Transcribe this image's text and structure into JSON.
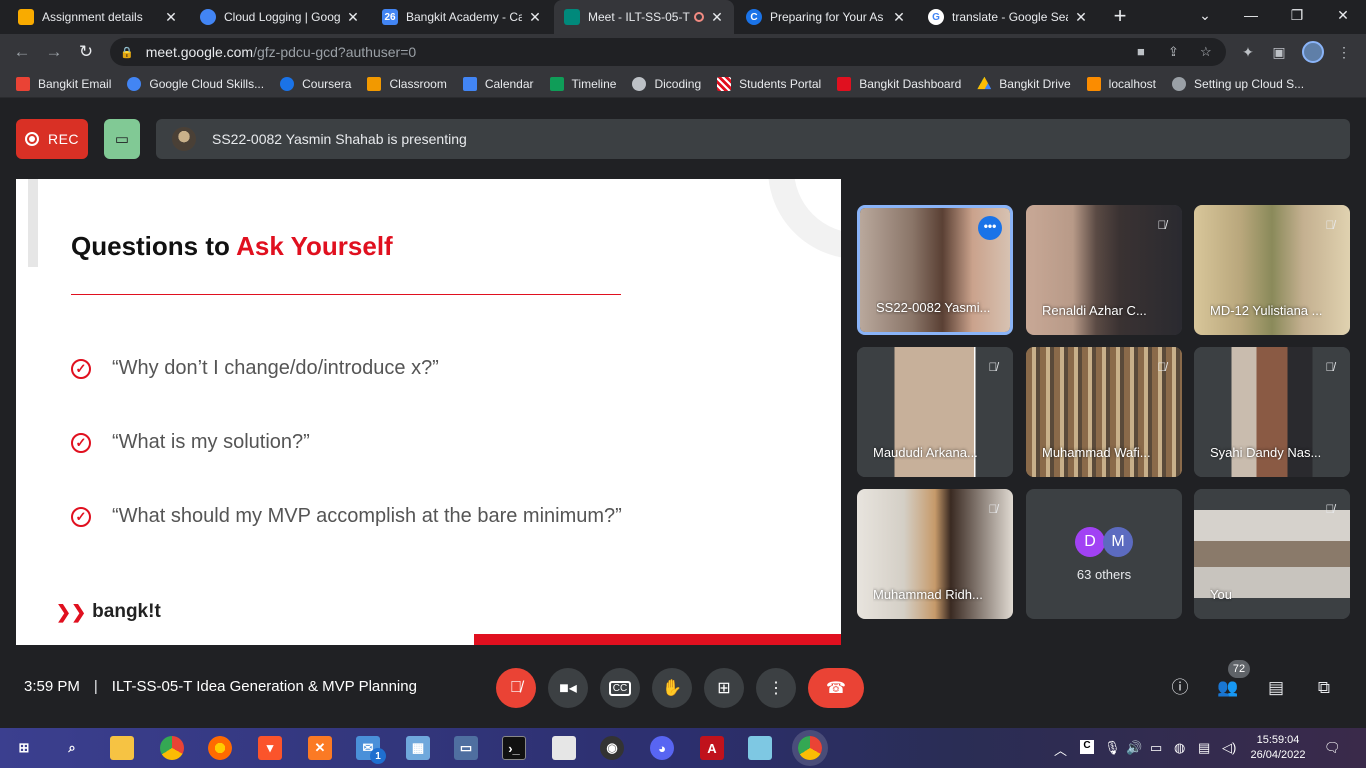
{
  "browser": {
    "tabs": [
      {
        "title": "Assignment details",
        "favicon_color": "#f9ab00"
      },
      {
        "title": "Cloud Logging | Goog",
        "favicon_color": "#4285f4"
      },
      {
        "title": "Bangkit Academy - Ca",
        "favicon_color": "#4285f4",
        "favicon_text": "26"
      },
      {
        "title": "Meet - ILT-SS-05-T",
        "favicon_color": "#00897b",
        "active": true,
        "recording": true
      },
      {
        "title": "Preparing for Your As",
        "favicon_color": "#1a73e8",
        "favicon_text": "C"
      },
      {
        "title": "translate - Google Sea",
        "favicon_color": "#ffffff",
        "favicon_text": "G"
      }
    ],
    "url_host": "meet.google.com",
    "url_path": "/gfz-pdcu-gcd?authuser=0",
    "bookmarks": [
      {
        "label": "Bangkit Email",
        "color": "#ea4335"
      },
      {
        "label": "Google Cloud Skills...",
        "color": "#4285f4"
      },
      {
        "label": "Coursera",
        "color": "#1a73e8"
      },
      {
        "label": "Classroom",
        "color": "#f29900"
      },
      {
        "label": "Calendar",
        "color": "#4285f4"
      },
      {
        "label": "Timeline",
        "color": "#0f9d58"
      },
      {
        "label": "Dicoding",
        "color": "#bdc1c6"
      },
      {
        "label": "Students Portal",
        "color": "#e0101f"
      },
      {
        "label": "Bangkit Dashboard",
        "color": "#e0101f"
      },
      {
        "label": "Bangkit Drive",
        "color": "#fbbc04"
      },
      {
        "label": "localhost",
        "color": "#fb8c00"
      },
      {
        "label": "Setting up Cloud S...",
        "color": "#9aa0a6"
      }
    ]
  },
  "meet": {
    "rec_label": "REC",
    "presenting_text": "SS22-0082 Yasmin Shahab is presenting",
    "slide": {
      "title_black": "Questions to ",
      "title_red": "Ask Yourself",
      "bullets": [
        "“Why don’t I change/do/introduce x?”",
        "“What is my solution?”",
        "“What should my MVP accomplish at the bare minimum?”"
      ],
      "logo_text": "bangk!t"
    },
    "participants": [
      {
        "name": "SS22-0082 Yasmi...",
        "speaking": true
      },
      {
        "name": "Renaldi Azhar C..."
      },
      {
        "name": "MD-12 Yulistiana ..."
      },
      {
        "name": "Maududi Arkana..."
      },
      {
        "name": "Muhammad Wafi..."
      },
      {
        "name": "Syahi Dandy Nas..."
      },
      {
        "name": "Muhammad Ridh..."
      },
      {
        "name": "You"
      }
    ],
    "others": {
      "initials": [
        "D",
        "M"
      ],
      "label": "63 others"
    },
    "time": "3:59 PM",
    "meeting_name": "ILT-SS-05-T Idea Generation & MVP Planning",
    "people_count": "72"
  },
  "taskbar": {
    "time": "15:59:04",
    "date": "26/04/2022",
    "mail_badge": "1"
  }
}
